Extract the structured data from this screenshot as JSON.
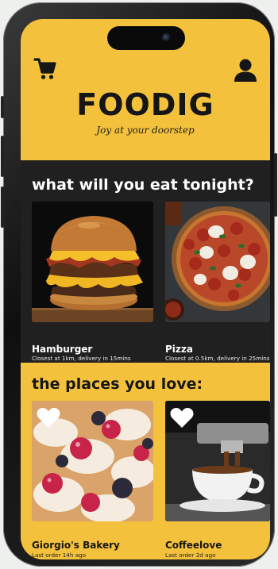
{
  "header": {
    "title": "FOODIG",
    "tagline": "Joy at your doorstep"
  },
  "tonight": {
    "title": "what will you eat tonight?",
    "items": [
      {
        "name": "Hamburger",
        "detail": "Closest at 1km, delivery in 15mins"
      },
      {
        "name": "Pizza",
        "detail": "Closest at 0.5km, delivery in 25mins"
      }
    ]
  },
  "places": {
    "title": "the places you love:",
    "items": [
      {
        "name": "Giorgio's Bakery",
        "detail": "Last order 14h ago"
      },
      {
        "name": "Coffeelove",
        "detail": "Last order 2d ago"
      }
    ]
  },
  "icons": {
    "cart": "shopping-cart-icon",
    "user": "user-profile-icon",
    "heart": "heart-icon"
  },
  "colors": {
    "brand_yellow": "#f3c13c",
    "dark_background": "#1f201f"
  }
}
